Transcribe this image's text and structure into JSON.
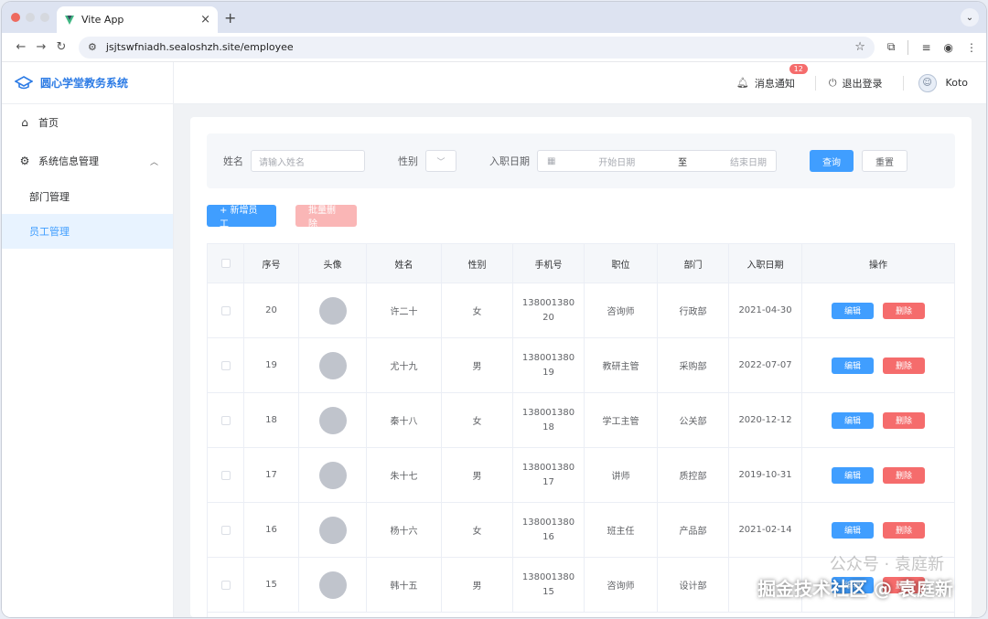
{
  "browser": {
    "tab_title": "Vite App",
    "url": "jsjtswfniadh.sealoshzh.site/employee"
  },
  "app": {
    "brand": "圆心学堂教务系统"
  },
  "sidebar": {
    "home": "首页",
    "system": "系统信息管理",
    "dept": "部门管理",
    "employee": "员工管理"
  },
  "header": {
    "notify": "消息通知",
    "notify_count": "12",
    "logout": "退出登录",
    "user": "Koto"
  },
  "search": {
    "name_label": "姓名",
    "name_placeholder": "请输入姓名",
    "gender_label": "性别",
    "date_label": "入职日期",
    "date_start": "开始日期",
    "date_sep": "至",
    "date_end": "结束日期",
    "query": "查询",
    "reset": "重置"
  },
  "actions": {
    "add": "+ 新增员工",
    "batch_delete": "批量删除"
  },
  "table": {
    "headers": [
      "序号",
      "头像",
      "姓名",
      "性别",
      "手机号",
      "职位",
      "部门",
      "入职日期",
      "操作"
    ],
    "edit": "编辑",
    "delete": "删除",
    "rows": [
      {
        "idx": "20",
        "name": "许二十",
        "sex": "女",
        "phone": "13800138020",
        "pos": "咨询师",
        "dept": "行政部",
        "date": "2021-04-30"
      },
      {
        "idx": "19",
        "name": "尤十九",
        "sex": "男",
        "phone": "13800138019",
        "pos": "教研主管",
        "dept": "采购部",
        "date": "2022-07-07"
      },
      {
        "idx": "18",
        "name": "秦十八",
        "sex": "女",
        "phone": "13800138018",
        "pos": "学工主管",
        "dept": "公关部",
        "date": "2020-12-12"
      },
      {
        "idx": "17",
        "name": "朱十七",
        "sex": "男",
        "phone": "13800138017",
        "pos": "讲师",
        "dept": "质控部",
        "date": "2019-10-31"
      },
      {
        "idx": "16",
        "name": "杨十六",
        "sex": "女",
        "phone": "13800138016",
        "pos": "班主任",
        "dept": "产品部",
        "date": "2021-02-14"
      },
      {
        "idx": "15",
        "name": "韩十五",
        "sex": "男",
        "phone": "13800138015",
        "pos": "咨询师",
        "dept": "设计部",
        "date": ""
      }
    ]
  },
  "watermark": {
    "line1": "公众号 · 袁庭新",
    "line2": "掘金技术社区 @ 袁庭新"
  }
}
